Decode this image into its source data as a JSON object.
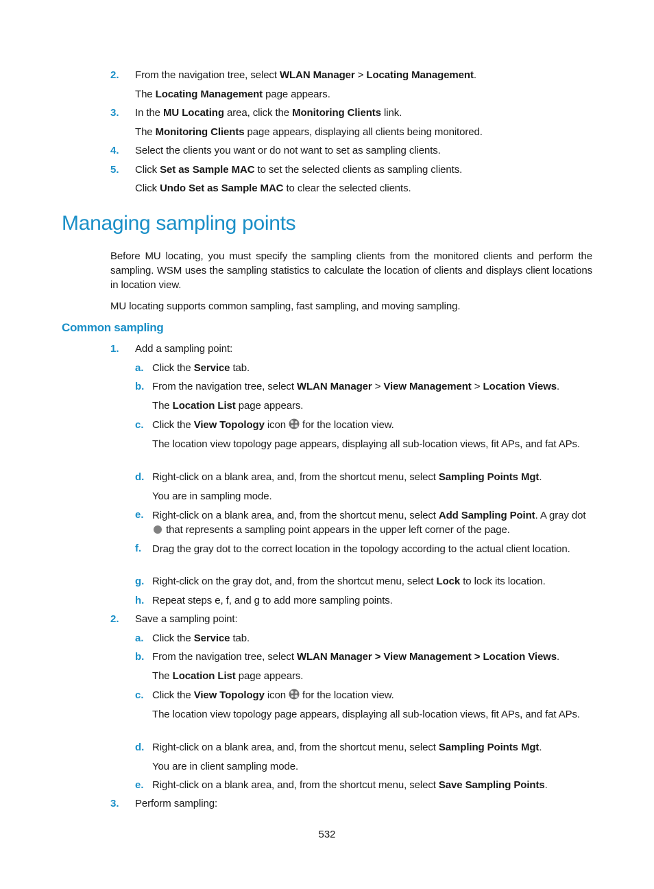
{
  "intro_steps": [
    {
      "num": "2.",
      "parts": [
        "From the navigation tree, select ",
        "WLAN Manager",
        " > ",
        "Locating Management",
        "."
      ],
      "note_parts": [
        "The ",
        "Locating Management",
        " page appears."
      ]
    },
    {
      "num": "3.",
      "parts": [
        "In the ",
        "MU Locating",
        " area, click the ",
        "Monitoring Clients",
        " link."
      ],
      "note_parts": [
        "The ",
        "Monitoring Clients",
        " page appears, displaying all clients being monitored."
      ]
    },
    {
      "num": "4.",
      "text": "Select the clients you want or do not want to set as sampling clients."
    },
    {
      "num": "5.",
      "parts": [
        "Click ",
        "Set as Sample MAC",
        " to set the selected clients as sampling clients."
      ],
      "note_parts": [
        "Click ",
        "Undo Set as Sample MAC",
        " to clear the selected clients."
      ]
    }
  ],
  "section_title": "Managing sampling points",
  "intro_paragraph": "Before MU locating, you must specify the sampling clients from the monitored clients and perform the sampling. WSM uses the sampling statistics to calculate the location of clients and displays client locations in location view.",
  "intro_paragraph2": "MU locating supports common sampling, fast sampling, and moving sampling.",
  "subsection_title": "Common sampling",
  "step1": {
    "num": "1.",
    "text": "Add a sampling point:",
    "a": {
      "letter": "a.",
      "p1": "Click the ",
      "b1": "Service",
      "p2": " tab."
    },
    "b": {
      "letter": "b.",
      "p1": "From the navigation tree, select ",
      "b1": "WLAN Manager",
      "p2": " > ",
      "b2": "View Management",
      "p3": " > ",
      "b3": "Location Views",
      "p4": ".",
      "note_p1": "The ",
      "note_b1": "Location List",
      "note_p2": " page appears."
    },
    "c": {
      "letter": "c.",
      "p1": "Click the ",
      "b1": "View Topology",
      "p2": " icon",
      "p3": "for the location view.",
      "note": "The location view topology page appears, displaying all sub-location views, fit APs, and fat APs.",
      "icon": "view-topology-icon"
    },
    "d": {
      "letter": "d.",
      "p1": "Right-click on a blank area, and, from the shortcut menu, select ",
      "b1": "Sampling Points Mgt",
      "p2": ".",
      "note": "You are in sampling mode."
    },
    "e": {
      "letter": "e.",
      "p1": "Right-click on a blank area, and, from the shortcut menu, select ",
      "b1": "Add Sampling Point",
      "p2": ". A gray dot",
      "p3": "that represents a sampling point appears in the upper left corner of the page.",
      "dot_color": "#808080"
    },
    "f": {
      "letter": "f.",
      "text": "Drag the gray dot to the correct location in the topology according to the actual client location."
    },
    "g": {
      "letter": "g.",
      "p1": "Right-click on the gray dot, and, from the shortcut menu, select ",
      "b1": "Lock",
      "p2": " to lock its location."
    },
    "h": {
      "letter": "h.",
      "text": "Repeat steps e, f, and g to add more sampling points."
    }
  },
  "step2": {
    "num": "2.",
    "text": "Save a sampling point:",
    "a": {
      "letter": "a.",
      "p1": "Click the ",
      "b1": "Service",
      "p2": " tab."
    },
    "b": {
      "letter": "b.",
      "p1": "From the navigation tree, select ",
      "b1": "WLAN Manager > View Management > Location Views",
      "p2": ".",
      "note_p1": "The ",
      "note_b1": "Location List",
      "note_p2": " page appears."
    },
    "c": {
      "letter": "c.",
      "p1": "Click the ",
      "b1": "View Topology",
      "p2": " icon",
      "p3": "for the location view.",
      "note": "The location view topology page appears, displaying all sub-location views, fit APs, and fat APs.",
      "icon": "view-topology-icon"
    },
    "d": {
      "letter": "d.",
      "p1": "Right-click on a blank area, and, from the shortcut menu, select ",
      "b1": "Sampling Points Mgt",
      "p2": ".",
      "note": "You are in client sampling mode."
    },
    "e": {
      "letter": "e.",
      "p1": "Right-click on a blank area, and, from the shortcut menu, select ",
      "b1": "Save Sampling Points",
      "p2": "."
    }
  },
  "step3": {
    "num": "3.",
    "text": "Perform sampling:"
  },
  "page_number": "532",
  "colors": {
    "accent": "#1a8fc7",
    "text": "#1a1a1a"
  }
}
